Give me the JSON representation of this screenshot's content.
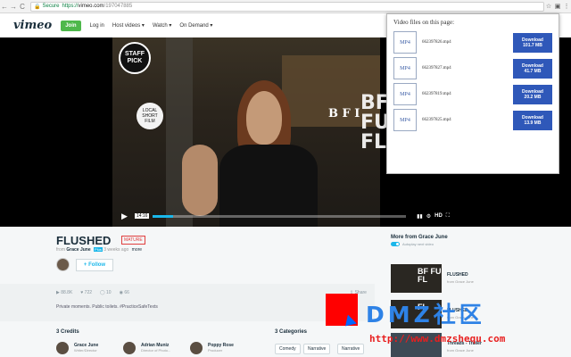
{
  "browser": {
    "back": "←",
    "forward": "→",
    "reload": "C",
    "secure_label": "Secure",
    "url_protocol": "https://",
    "url_host": "vimeo.com",
    "url_path": "/197047885",
    "bookmark": "☆"
  },
  "header": {
    "logo": "vimeo",
    "join": "Join",
    "nav": [
      "Log in",
      "Host videos ▾",
      "Watch ▾",
      "On Demand ▾"
    ]
  },
  "player": {
    "staff_pick": "STAFF PICK",
    "festival_badge": "LOCAL SHORT FILM",
    "bfi": "B F I",
    "bfi_big": "BF\nFU\nFL",
    "time": "14:16",
    "progress": 0.08,
    "hd": "HD"
  },
  "popup": {
    "title": "Video files on this page:",
    "files": [
      {
        "type": "MP4",
        "name": "662397826.mp4",
        "button": "Download",
        "size": "101.7 MB"
      },
      {
        "type": "MP4",
        "name": "662397827.mp4",
        "button": "Download",
        "size": "41.7 MB"
      },
      {
        "type": "MP4",
        "name": "662397819.mp4",
        "button": "Download",
        "size": "20.2 MB"
      },
      {
        "type": "MP4",
        "name": "662397825.mp4",
        "button": "Download",
        "size": "13.9 MB"
      }
    ]
  },
  "video": {
    "title": "FLUSHED",
    "rating": "MATURE",
    "from": "from",
    "author": "Grace June",
    "plus": "Plus",
    "ago": "3 weeks ago",
    "more": "more",
    "follow": "+ Follow",
    "stats": [
      "▶ 88.8K",
      "♥ 722",
      "◯ 10",
      "◉ 66"
    ],
    "share": "⇪ Share",
    "description": "Private moments. Public toilets. #PracticeSafeTexts"
  },
  "credits": {
    "heading": "3 Credits",
    "people": [
      {
        "name": "Grace June",
        "role": "Writer/Director"
      },
      {
        "name": "Adrian Muniz",
        "role": "Director of Photo..."
      },
      {
        "name": "Poppy Rose",
        "role": "Producer"
      }
    ]
  },
  "categories": {
    "heading": "3 Categories",
    "tags": [
      "Comedy",
      "Narrative",
      "Narrative"
    ]
  },
  "sidebar": {
    "heading": "More from Grace June",
    "autoplay": "Autoplay next video",
    "items": [
      {
        "title": "FLUSHED",
        "author": "from Grace June",
        "thumb": "BF FU FL"
      },
      {
        "title": "FLUSHED",
        "author": "from Grace June",
        "thumb": "FL"
      },
      {
        "title": "Threads - Trailer",
        "author": "from Grace June",
        "thumb": ""
      }
    ]
  },
  "watermark": {
    "text": "DMZ社区",
    "url": "http://www.dmzshequ.com"
  },
  "colors": {
    "vimeo_blue": "#1ab7ea",
    "join_green": "#4eb84b",
    "download_blue": "#2f58b9",
    "mature_red": "#e03e3e"
  }
}
